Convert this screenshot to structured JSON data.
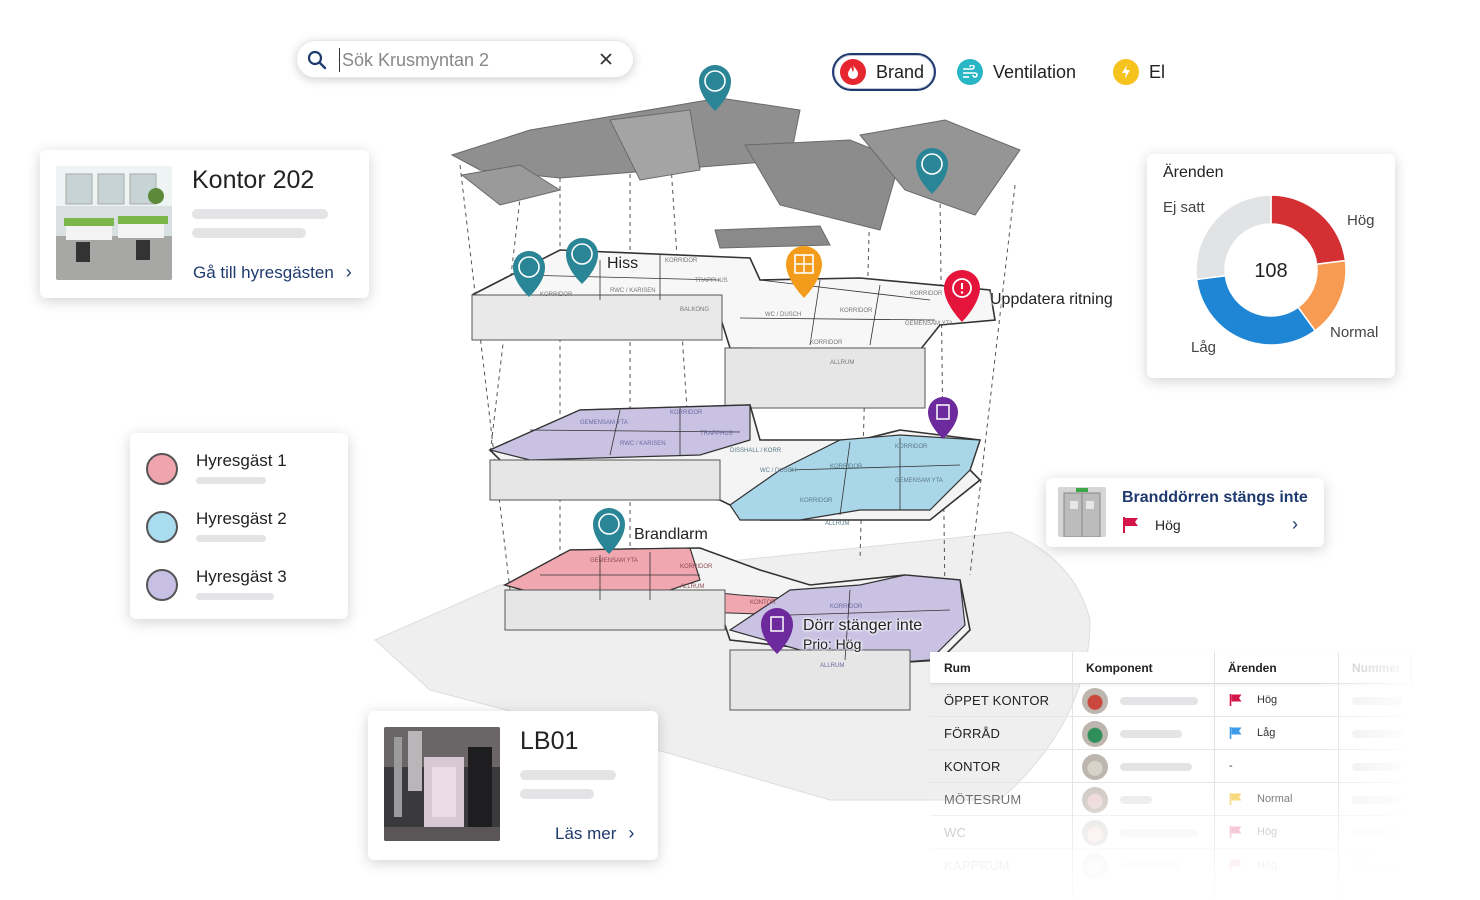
{
  "search": {
    "placeholder": "Sök Krusmyntan 2"
  },
  "filters": [
    {
      "label": "Brand",
      "color": "#e8262f",
      "icon": "fire-icon"
    },
    {
      "label": "Ventilation",
      "color": "#29b6c6",
      "icon": "wind-icon"
    },
    {
      "label": "El",
      "color": "#f6c21c",
      "icon": "bolt-icon"
    }
  ],
  "tenant_card": {
    "title": "Kontor 202",
    "link": "Gå till hyresgästen"
  },
  "legend": {
    "items": [
      {
        "label": "Hyresgäst 1",
        "color": "#f0a4ad"
      },
      {
        "label": "Hyresgäst 2",
        "color": "#a9dcef"
      },
      {
        "label": "Hyresgäst 3",
        "color": "#c7c0e4"
      }
    ]
  },
  "lb_card": {
    "title": "LB01",
    "link": "Läs mer"
  },
  "issues_chart": {
    "title": "Ärenden",
    "total": "108",
    "segments": [
      {
        "label": "Hög",
        "fraction": 0.23,
        "color": "#d42f32"
      },
      {
        "label": "Normal",
        "fraction": 0.17,
        "color": "#f79a52"
      },
      {
        "label": "Låg",
        "fraction": 0.33,
        "color": "#1f86d6"
      },
      {
        "label": "Ej satt",
        "fraction": 0.27,
        "color": "#e2e3e5"
      }
    ]
  },
  "alert_card": {
    "title": "Branddörren stängs inte",
    "priority": "Hög",
    "flag_color": "#d4154a"
  },
  "map_labels": {
    "hiss": "Hiss",
    "uppdatera": "Uppdatera ritning",
    "brandlarm": "Brandlarm",
    "dorr_line1": "Dörr stänger inte",
    "dorr_line2": "Prio: Hög"
  },
  "table": {
    "headers": [
      "Rum",
      "Komponent",
      "Ärenden",
      "Nummer"
    ],
    "rows": [
      {
        "room": "ÖPPET KONTOR",
        "priority": "Hög",
        "flag_color": "#d4154a",
        "opacity": 1
      },
      {
        "room": "FÖRRÅD",
        "priority": "Låg",
        "flag_color": "#3d9be9",
        "opacity": 1
      },
      {
        "room": "KONTOR",
        "priority": "-",
        "flag_color": "",
        "opacity": 1
      },
      {
        "room": "MÖTESRUM",
        "priority": "Normal",
        "flag_color": "#f6c43a",
        "opacity": 0.7
      },
      {
        "room": "WC",
        "priority": "Hög",
        "flag_color": "#d4154a",
        "opacity": 0.35
      },
      {
        "room": "KAPPRUM",
        "priority": "Hög",
        "flag_color": "#d4154a",
        "opacity": 0.15
      }
    ]
  }
}
